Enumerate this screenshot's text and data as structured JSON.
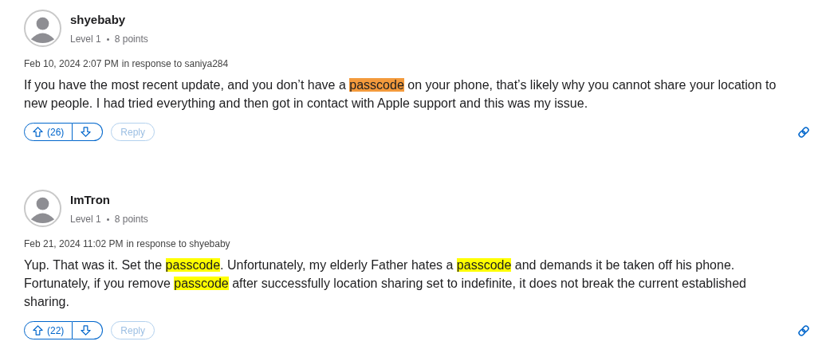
{
  "posts": [
    {
      "author": "shyebaby",
      "level": "Level 1",
      "points": "8 points",
      "date": "Feb 10, 2024 2:07 PM",
      "response": "in response to saniya284",
      "body": [
        {
          "text": "If you have the most recent update, and you don’t have a ",
          "kind": "plain"
        },
        {
          "text": "passcode",
          "kind": "current-match"
        },
        {
          "text": " on your phone, that’s likely why you cannot share your location to new people. I had tried everything and then got in contact with Apple support and this was my issue.",
          "kind": "plain"
        }
      ],
      "upvotes": "(26)",
      "reply": "Reply"
    },
    {
      "author": "ImTron",
      "level": "Level 1",
      "points": "8 points",
      "date": "Feb 21, 2024 11:02 PM",
      "response": "in response to shyebaby",
      "body": [
        {
          "text": "Yup. That was it. Set the ",
          "kind": "plain"
        },
        {
          "text": "passcode",
          "kind": "match"
        },
        {
          "text": ". Unfortunately, my elderly Father hates a ",
          "kind": "plain"
        },
        {
          "text": "passcode",
          "kind": "match"
        },
        {
          "text": " and demands it be taken off his phone. Fortunately, if you remove ",
          "kind": "plain"
        },
        {
          "text": "passcode",
          "kind": "match"
        },
        {
          "text": " after successfully location sharing set to indefinite, it does not break the current established sharing.",
          "kind": "plain"
        }
      ],
      "upvotes": "(22)",
      "reply": "Reply"
    }
  ]
}
